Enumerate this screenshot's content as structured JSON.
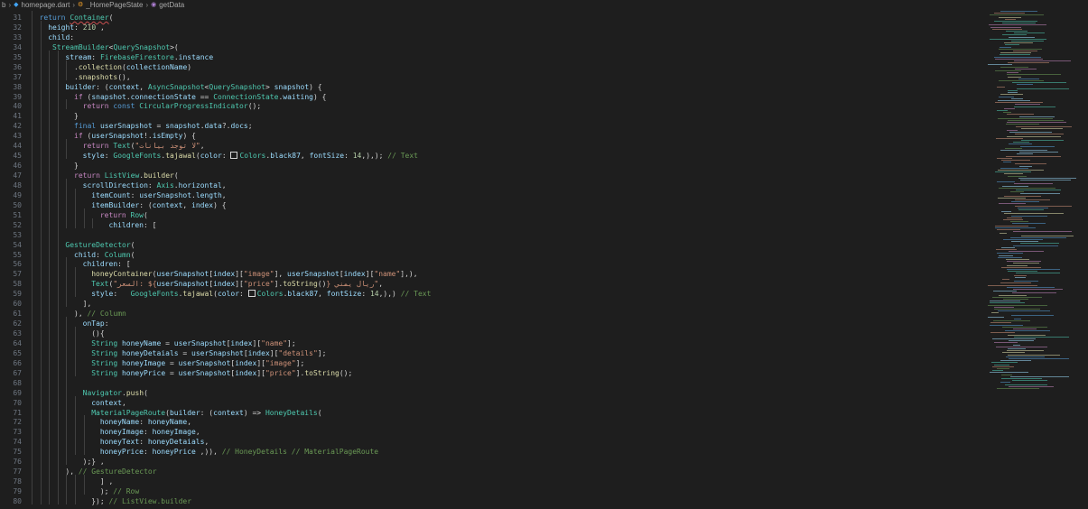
{
  "breadcrumb": {
    "folder": "b",
    "file": "homepage.dart",
    "cls": "_HomePageState",
    "method": "getData"
  },
  "lines": [
    {
      "n": "31",
      "i": 1,
      "seg": [
        [
          "k",
          "return "
        ],
        [
          "t",
          "Container"
        ],
        [
          "p",
          "("
        ]
      ]
    },
    {
      "n": "32",
      "i": 2,
      "seg": [
        [
          "v",
          "height"
        ],
        [
          "p",
          ": "
        ],
        [
          "n",
          "210"
        ],
        [
          "p",
          " ,"
        ]
      ]
    },
    {
      "n": "33",
      "i": 2,
      "seg": [
        [
          "v",
          "child"
        ],
        [
          "p",
          ":"
        ]
      ]
    },
    {
      "n": "34",
      "i": 2,
      "seg": [
        [
          "p",
          " "
        ],
        [
          "t",
          "StreamBuilder"
        ],
        [
          "p",
          "<"
        ],
        [
          "t",
          "QuerySnapshot"
        ],
        [
          "p",
          ">("
        ]
      ]
    },
    {
      "n": "35",
      "i": 4,
      "seg": [
        [
          "v",
          "stream"
        ],
        [
          "p",
          ": "
        ],
        [
          "t",
          "FirebaseFirestore"
        ],
        [
          "p",
          "."
        ],
        [
          "v",
          "instance"
        ]
      ]
    },
    {
      "n": "36",
      "i": 5,
      "seg": [
        [
          "p",
          "."
        ],
        [
          "f",
          "collection"
        ],
        [
          "p",
          "("
        ],
        [
          "v",
          "collectionName"
        ],
        [
          "p",
          ")"
        ]
      ]
    },
    {
      "n": "37",
      "i": 5,
      "seg": [
        [
          "p",
          "."
        ],
        [
          "f",
          "snapshots"
        ],
        [
          "p",
          "(),"
        ]
      ]
    },
    {
      "n": "38",
      "i": 4,
      "seg": [
        [
          "v",
          "builder"
        ],
        [
          "p",
          ": ("
        ],
        [
          "v",
          "context"
        ],
        [
          "p",
          ", "
        ],
        [
          "t",
          "AsyncSnapshot"
        ],
        [
          "p",
          "<"
        ],
        [
          "t",
          "QuerySnapshot"
        ],
        [
          "p",
          "> "
        ],
        [
          "v",
          "snapshot"
        ],
        [
          "p",
          ") {"
        ]
      ]
    },
    {
      "n": "39",
      "i": 4,
      "seg": [
        [
          "p",
          "  "
        ],
        [
          "c",
          "if "
        ],
        [
          "p",
          "("
        ],
        [
          "v",
          "snapshot"
        ],
        [
          "p",
          "."
        ],
        [
          "v",
          "connectionState"
        ],
        [
          "p",
          " == "
        ],
        [
          "t",
          "ConnectionState"
        ],
        [
          "p",
          "."
        ],
        [
          "v",
          "waiting"
        ],
        [
          "p",
          ") {"
        ]
      ]
    },
    {
      "n": "40",
      "i": 5,
      "seg": [
        [
          "p",
          "  "
        ],
        [
          "c",
          "return "
        ],
        [
          "k",
          "const "
        ],
        [
          "t",
          "CircularProgressIndicator"
        ],
        [
          "p",
          "();"
        ]
      ]
    },
    {
      "n": "41",
      "i": 4,
      "seg": [
        [
          "p",
          "  }"
        ]
      ]
    },
    {
      "n": "42",
      "i": 4,
      "seg": [
        [
          "p",
          "  "
        ],
        [
          "k",
          "final "
        ],
        [
          "v",
          "userSnapshot"
        ],
        [
          "p",
          " = "
        ],
        [
          "v",
          "snapshot"
        ],
        [
          "p",
          "."
        ],
        [
          "v",
          "data"
        ],
        [
          "p",
          "?."
        ],
        [
          "v",
          "docs"
        ],
        [
          "p",
          ";"
        ]
      ]
    },
    {
      "n": "43",
      "i": 4,
      "seg": [
        [
          "p",
          "  "
        ],
        [
          "c",
          "if "
        ],
        [
          "p",
          "("
        ],
        [
          "v",
          "userSnapshot"
        ],
        [
          "p",
          "!."
        ],
        [
          "v",
          "isEmpty"
        ],
        [
          "p",
          ") {"
        ]
      ]
    },
    {
      "n": "44",
      "i": 5,
      "seg": [
        [
          "p",
          "  "
        ],
        [
          "c",
          "return "
        ],
        [
          "t",
          "Text"
        ],
        [
          "p",
          "("
        ],
        [
          "s",
          "\"لا توجد بيانات\""
        ],
        [
          "p",
          ","
        ]
      ]
    },
    {
      "n": "45",
      "i": 5,
      "seg": [
        [
          "p",
          "  "
        ],
        [
          "v",
          "style"
        ],
        [
          "p",
          ": "
        ],
        [
          "t",
          "GoogleFonts"
        ],
        [
          "p",
          "."
        ],
        [
          "f",
          "tajawal"
        ],
        [
          "p",
          "("
        ],
        [
          "v",
          "color"
        ],
        [
          "p",
          ": "
        ],
        [
          "sw",
          ""
        ],
        [
          "t",
          "Colors"
        ],
        [
          "p",
          "."
        ],
        [
          "v",
          "black87"
        ],
        [
          "p",
          ", "
        ],
        [
          "v",
          "fontSize"
        ],
        [
          "p",
          ": "
        ],
        [
          "n",
          "14"
        ],
        [
          "p",
          ",),); "
        ],
        [
          "m",
          "// Text"
        ]
      ]
    },
    {
      "n": "46",
      "i": 4,
      "seg": [
        [
          "p",
          "  }"
        ]
      ]
    },
    {
      "n": "47",
      "i": 4,
      "seg": [
        [
          "p",
          "  "
        ],
        [
          "c",
          "return "
        ],
        [
          "t",
          "ListView"
        ],
        [
          "p",
          "."
        ],
        [
          "f",
          "builder"
        ],
        [
          "p",
          "("
        ]
      ]
    },
    {
      "n": "48",
      "i": 5,
      "seg": [
        [
          "p",
          "  "
        ],
        [
          "v",
          "scrollDirection"
        ],
        [
          "p",
          ": "
        ],
        [
          "t",
          "Axis"
        ],
        [
          "p",
          "."
        ],
        [
          "v",
          "horizontal"
        ],
        [
          "p",
          ","
        ]
      ]
    },
    {
      "n": "49",
      "i": 6,
      "seg": [
        [
          "p",
          "  "
        ],
        [
          "v",
          "itemCount"
        ],
        [
          "p",
          ": "
        ],
        [
          "v",
          "userSnapshot"
        ],
        [
          "p",
          "."
        ],
        [
          "v",
          "length"
        ],
        [
          "p",
          ","
        ]
      ]
    },
    {
      "n": "50",
      "i": 6,
      "seg": [
        [
          "p",
          "  "
        ],
        [
          "v",
          "itemBuilder"
        ],
        [
          "p",
          ": ("
        ],
        [
          "v",
          "context"
        ],
        [
          "p",
          ", "
        ],
        [
          "v",
          "index"
        ],
        [
          "p",
          ") {"
        ]
      ]
    },
    {
      "n": "51",
      "i": 7,
      "seg": [
        [
          "p",
          "  "
        ],
        [
          "c",
          "return "
        ],
        [
          "t",
          "Row"
        ],
        [
          "p",
          "("
        ]
      ]
    },
    {
      "n": "52",
      "i": 8,
      "seg": [
        [
          "p",
          "  "
        ],
        [
          "v",
          "children"
        ],
        [
          "p",
          ": ["
        ]
      ]
    },
    {
      "n": "53",
      "i": 4,
      "seg": []
    },
    {
      "n": "54",
      "i": 4,
      "seg": [
        [
          "t",
          "GestureDetector"
        ],
        [
          "p",
          "("
        ]
      ]
    },
    {
      "n": "55",
      "i": 4,
      "seg": [
        [
          "p",
          "  "
        ],
        [
          "v",
          "child"
        ],
        [
          "p",
          ": "
        ],
        [
          "t",
          "Column"
        ],
        [
          "p",
          "("
        ]
      ]
    },
    {
      "n": "56",
      "i": 5,
      "seg": [
        [
          "p",
          "  "
        ],
        [
          "v",
          "children"
        ],
        [
          "p",
          ": ["
        ]
      ]
    },
    {
      "n": "57",
      "i": 6,
      "seg": [
        [
          "p",
          "  "
        ],
        [
          "f",
          "honeyContainer"
        ],
        [
          "p",
          "("
        ],
        [
          "v",
          "userSnapshot"
        ],
        [
          "p",
          "["
        ],
        [
          "v",
          "index"
        ],
        [
          "p",
          "]["
        ],
        [
          "s",
          "\"image\""
        ],
        [
          "p",
          "], "
        ],
        [
          "v",
          "userSnapshot"
        ],
        [
          "p",
          "["
        ],
        [
          "v",
          "index"
        ],
        [
          "p",
          "]["
        ],
        [
          "s",
          "\"name\""
        ],
        [
          "p",
          "],),"
        ]
      ]
    },
    {
      "n": "58",
      "i": 6,
      "seg": [
        [
          "p",
          "  "
        ],
        [
          "t",
          "Text"
        ],
        [
          "p",
          "("
        ],
        [
          "s",
          "\"السعر: ${"
        ],
        [
          "v",
          "userSnapshot"
        ],
        [
          "p",
          "["
        ],
        [
          "v",
          "index"
        ],
        [
          "p",
          "]["
        ],
        [
          "s",
          "\"price\""
        ],
        [
          "p",
          "]."
        ],
        [
          "f",
          "toString"
        ],
        [
          "p",
          "()"
        ],
        [
          "s",
          "} ريال يمني\""
        ],
        [
          "p",
          ","
        ]
      ]
    },
    {
      "n": "59",
      "i": 6,
      "seg": [
        [
          "p",
          "  "
        ],
        [
          "v",
          "style"
        ],
        [
          "p",
          ":   "
        ],
        [
          "t",
          "GoogleFonts"
        ],
        [
          "p",
          "."
        ],
        [
          "f",
          "tajawal"
        ],
        [
          "p",
          "("
        ],
        [
          "v",
          "color"
        ],
        [
          "p",
          ": "
        ],
        [
          "sw",
          ""
        ],
        [
          "t",
          "Colors"
        ],
        [
          "p",
          "."
        ],
        [
          "v",
          "black87"
        ],
        [
          "p",
          ", "
        ],
        [
          "v",
          "fontSize"
        ],
        [
          "p",
          ": "
        ],
        [
          "n",
          "14"
        ],
        [
          "p",
          ",),) "
        ],
        [
          "m",
          "// Text"
        ]
      ]
    },
    {
      "n": "60",
      "i": 5,
      "seg": [
        [
          "p",
          "  ],"
        ]
      ]
    },
    {
      "n": "61",
      "i": 4,
      "seg": [
        [
          "p",
          "  ), "
        ],
        [
          "m",
          "// Column"
        ]
      ]
    },
    {
      "n": "62",
      "i": 5,
      "seg": [
        [
          "p",
          "  "
        ],
        [
          "v",
          "onTap"
        ],
        [
          "p",
          ":"
        ]
      ]
    },
    {
      "n": "63",
      "i": 6,
      "seg": [
        [
          "p",
          "  (){"
        ]
      ]
    },
    {
      "n": "64",
      "i": 6,
      "seg": [
        [
          "p",
          "  "
        ],
        [
          "t",
          "String"
        ],
        [
          "p",
          " "
        ],
        [
          "v",
          "honeyName"
        ],
        [
          "p",
          " = "
        ],
        [
          "v",
          "userSnapshot"
        ],
        [
          "p",
          "["
        ],
        [
          "v",
          "index"
        ],
        [
          "p",
          "]["
        ],
        [
          "s",
          "\"name\""
        ],
        [
          "p",
          "];"
        ]
      ]
    },
    {
      "n": "65",
      "i": 6,
      "seg": [
        [
          "p",
          "  "
        ],
        [
          "t",
          "String"
        ],
        [
          "p",
          " "
        ],
        [
          "v",
          "honeyDetaials"
        ],
        [
          "p",
          " = "
        ],
        [
          "v",
          "userSnapshot"
        ],
        [
          "p",
          "["
        ],
        [
          "v",
          "index"
        ],
        [
          "p",
          "]["
        ],
        [
          "s",
          "\"details\""
        ],
        [
          "p",
          "];"
        ]
      ]
    },
    {
      "n": "66",
      "i": 6,
      "seg": [
        [
          "p",
          "  "
        ],
        [
          "t",
          "String"
        ],
        [
          "p",
          " "
        ],
        [
          "v",
          "honeyImage"
        ],
        [
          "p",
          " = "
        ],
        [
          "v",
          "userSnapshot"
        ],
        [
          "p",
          "["
        ],
        [
          "v",
          "index"
        ],
        [
          "p",
          "]["
        ],
        [
          "s",
          "\"image\""
        ],
        [
          "p",
          "];"
        ]
      ]
    },
    {
      "n": "67",
      "i": 6,
      "seg": [
        [
          "p",
          "  "
        ],
        [
          "t",
          "String"
        ],
        [
          "p",
          " "
        ],
        [
          "v",
          "honeyPrice"
        ],
        [
          "p",
          " = "
        ],
        [
          "v",
          "userSnapshot"
        ],
        [
          "p",
          "["
        ],
        [
          "v",
          "index"
        ],
        [
          "p",
          "]["
        ],
        [
          "s",
          "\"price\""
        ],
        [
          "p",
          "]."
        ],
        [
          "f",
          "toString"
        ],
        [
          "p",
          "();"
        ]
      ]
    },
    {
      "n": "68",
      "i": 5,
      "seg": []
    },
    {
      "n": "69",
      "i": 5,
      "seg": [
        [
          "p",
          "  "
        ],
        [
          "t",
          "Navigator"
        ],
        [
          "p",
          "."
        ],
        [
          "f",
          "push"
        ],
        [
          "p",
          "("
        ]
      ]
    },
    {
      "n": "70",
      "i": 6,
      "seg": [
        [
          "p",
          "  "
        ],
        [
          "v",
          "context"
        ],
        [
          "p",
          ","
        ]
      ]
    },
    {
      "n": "71",
      "i": 6,
      "seg": [
        [
          "p",
          "  "
        ],
        [
          "t",
          "MaterialPageRoute"
        ],
        [
          "p",
          "("
        ],
        [
          "v",
          "builder"
        ],
        [
          "p",
          ": ("
        ],
        [
          "v",
          "context"
        ],
        [
          "p",
          ") => "
        ],
        [
          "t",
          "HoneyDetails"
        ],
        [
          "p",
          "("
        ]
      ]
    },
    {
      "n": "72",
      "i": 7,
      "seg": [
        [
          "p",
          "  "
        ],
        [
          "v",
          "honeyName"
        ],
        [
          "p",
          ": "
        ],
        [
          "v",
          "honeyName"
        ],
        [
          "p",
          ","
        ]
      ]
    },
    {
      "n": "73",
      "i": 7,
      "seg": [
        [
          "p",
          "  "
        ],
        [
          "v",
          "honeyImage"
        ],
        [
          "p",
          ": "
        ],
        [
          "v",
          "honeyImage"
        ],
        [
          "p",
          ","
        ]
      ]
    },
    {
      "n": "74",
      "i": 7,
      "seg": [
        [
          "p",
          "  "
        ],
        [
          "v",
          "honeyText"
        ],
        [
          "p",
          ": "
        ],
        [
          "v",
          "honeyDetaials"
        ],
        [
          "p",
          ","
        ]
      ]
    },
    {
      "n": "75",
      "i": 7,
      "seg": [
        [
          "p",
          "  "
        ],
        [
          "v",
          "honeyPrice"
        ],
        [
          "p",
          ": "
        ],
        [
          "v",
          "honeyPrice"
        ],
        [
          "p",
          " ,)), "
        ],
        [
          "m",
          "// HoneyDetails // MaterialPageRoute"
        ]
      ]
    },
    {
      "n": "76",
      "i": 5,
      "seg": [
        [
          "p",
          "  );} ,"
        ]
      ]
    },
    {
      "n": "77",
      "i": 4,
      "seg": [
        [
          "p",
          "), "
        ],
        [
          "m",
          "// GestureDetector"
        ]
      ]
    },
    {
      "n": "78",
      "i": 7,
      "seg": [
        [
          "p",
          "  ] ,"
        ]
      ]
    },
    {
      "n": "79",
      "i": 7,
      "seg": [
        [
          "p",
          "  ); "
        ],
        [
          "m",
          "// Row"
        ]
      ]
    },
    {
      "n": "80",
      "i": 6,
      "seg": [
        [
          "p",
          "  }); "
        ],
        [
          "m",
          "// ListView.builder"
        ]
      ]
    }
  ]
}
